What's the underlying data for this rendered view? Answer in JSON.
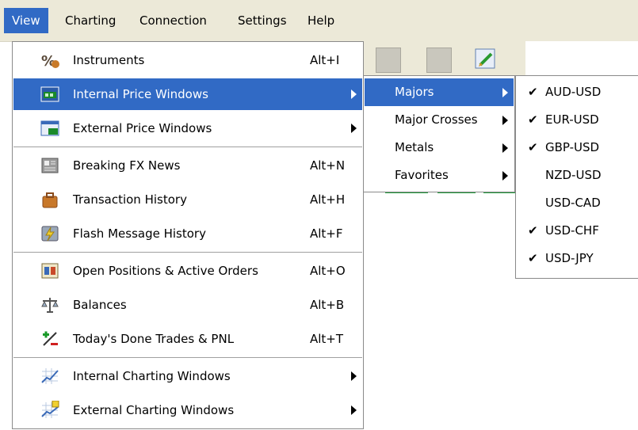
{
  "menubar": {
    "items": [
      {
        "label": "View",
        "active": true
      },
      {
        "label": "Charting"
      },
      {
        "label": "Connection"
      },
      {
        "label": "Settings"
      },
      {
        "label": "Help"
      }
    ]
  },
  "view_menu": {
    "items": [
      {
        "label": "Instruments",
        "shortcut": "Alt+I",
        "icon": "percent-icon"
      },
      {
        "label": "Internal Price Windows",
        "shortcut": "",
        "icon": "internal-price-window-icon",
        "submenu": true,
        "highlighted": true
      },
      {
        "label": "External Price Windows",
        "shortcut": "",
        "icon": "external-price-window-icon",
        "submenu": true
      },
      {
        "label": "Breaking FX News",
        "shortcut": "Alt+N",
        "icon": "news-icon"
      },
      {
        "label": "Transaction History",
        "shortcut": "Alt+H",
        "icon": "history-icon"
      },
      {
        "label": "Flash Message History",
        "shortcut": "Alt+F",
        "icon": "flash-message-icon"
      },
      {
        "label": "Open Positions & Active Orders",
        "shortcut": "Alt+O",
        "icon": "positions-icon"
      },
      {
        "label": "Balances",
        "shortcut": "Alt+B",
        "icon": "balance-scale-icon"
      },
      {
        "label": "Today's Done Trades & PNL",
        "shortcut": "Alt+T",
        "icon": "plus-minus-icon"
      },
      {
        "label": "Internal Charting Windows",
        "shortcut": "",
        "icon": "internal-chart-icon",
        "submenu": true
      },
      {
        "label": "External Charting Windows",
        "shortcut": "",
        "icon": "external-chart-icon",
        "submenu": true
      }
    ]
  },
  "price_submenu": {
    "items": [
      {
        "label": "Majors",
        "highlighted": true
      },
      {
        "label": "Major Crosses"
      },
      {
        "label": "Metals"
      },
      {
        "label": "Favorites"
      }
    ]
  },
  "majors_submenu": {
    "items": [
      {
        "label": "AUD-USD",
        "checked": true
      },
      {
        "label": "EUR-USD",
        "checked": true
      },
      {
        "label": "GBP-USD",
        "checked": true
      },
      {
        "label": "NZD-USD",
        "checked": false
      },
      {
        "label": "USD-CAD",
        "checked": false
      },
      {
        "label": "USD-CHF",
        "checked": true
      },
      {
        "label": "USD-JPY",
        "checked": true
      }
    ],
    "check_glyph": "✔"
  },
  "colors": {
    "highlight": "#316ac5",
    "menubar_bg": "#ece9d8"
  }
}
